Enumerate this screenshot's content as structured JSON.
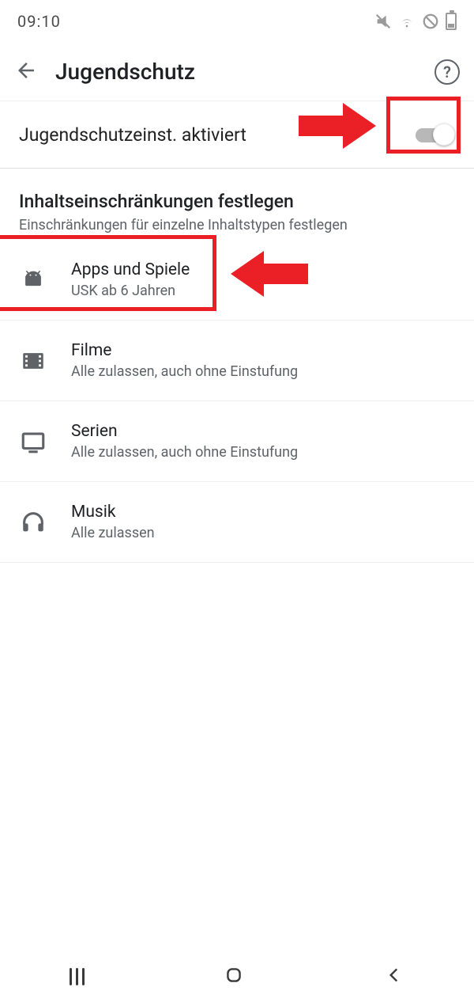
{
  "statusbar": {
    "time": "09:10"
  },
  "appbar": {
    "title": "Jugendschutz"
  },
  "activate": {
    "label": "Jugendschutzeinst. aktiviert",
    "on": true
  },
  "section": {
    "title": "Inhaltseinschränkungen festlegen",
    "subtitle": "Einschränkungen für einzelne Inhaltstypen festlegen"
  },
  "items": [
    {
      "icon": "android-icon",
      "title": "Apps und Spiele",
      "subtitle": "USK ab 6 Jahren"
    },
    {
      "icon": "film-icon",
      "title": "Filme",
      "subtitle": "Alle zulassen, auch ohne Einstufung"
    },
    {
      "icon": "tv-icon",
      "title": "Serien",
      "subtitle": "Alle zulassen, auch ohne Einstufung"
    },
    {
      "icon": "headphones-icon",
      "title": "Musik",
      "subtitle": "Alle zulassen"
    }
  ]
}
